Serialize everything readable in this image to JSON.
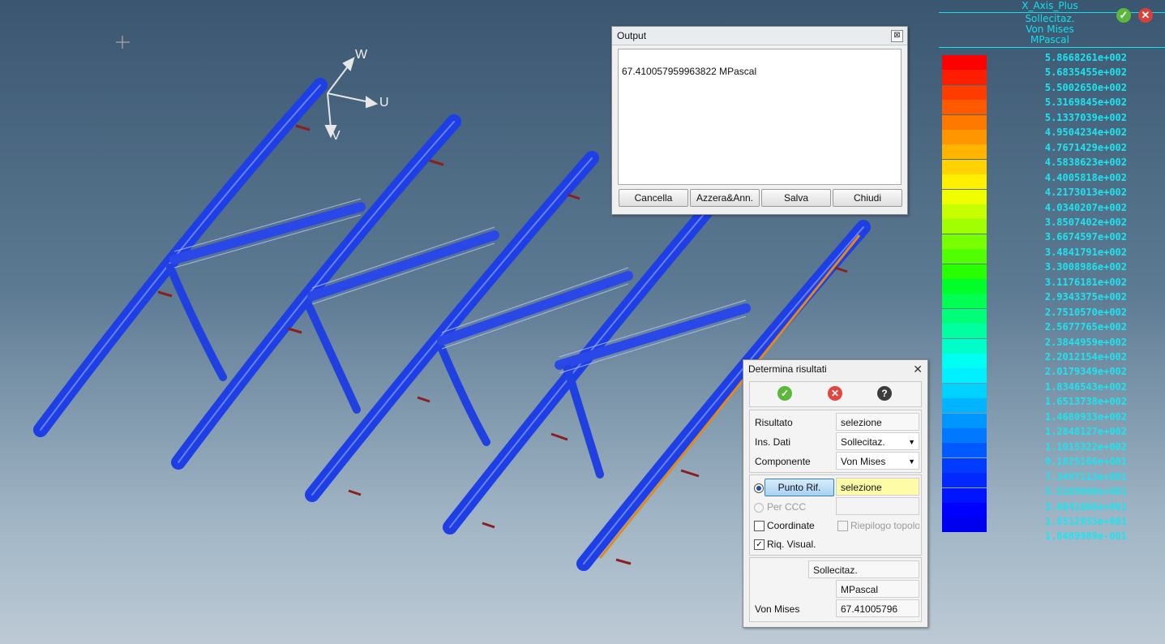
{
  "viewport": {
    "axes": {
      "w": "W",
      "u": "U",
      "v": "V"
    },
    "beam_color": "#1f3fe0",
    "background_top": "#3a5670"
  },
  "legend": {
    "title": "X_Axis_Plus",
    "line1": "Sollecitaz.",
    "line2": "Von Mises",
    "line3": "MPascal",
    "values": [
      "5.8668261e+002",
      "5.6835455e+002",
      "5.5002650e+002",
      "5.3169845e+002",
      "5.1337039e+002",
      "4.9504234e+002",
      "4.7671429e+002",
      "4.5838623e+002",
      "4.4005818e+002",
      "4.2173013e+002",
      "4.0340207e+002",
      "3.8507402e+002",
      "3.6674597e+002",
      "3.4841791e+002",
      "3.3008986e+002",
      "3.1176181e+002",
      "2.9343375e+002",
      "2.7510570e+002",
      "2.5677765e+002",
      "2.3844959e+002",
      "2.2012154e+002",
      "2.0179349e+002",
      "1.8346543e+002",
      "1.6513738e+002",
      "1.4680933e+002",
      "1.2848127e+002",
      "1.1015322e+002",
      "9.1825166e+001",
      "7.3497113e+001",
      "5.5169060e+001",
      "3.6841006e+001",
      "1.8512953e+001",
      "1.8489989e-001"
    ],
    "colors": [
      "#ff0000",
      "#ff1e00",
      "#ff3c00",
      "#ff5a00",
      "#ff7800",
      "#ff9600",
      "#ffb400",
      "#ffd200",
      "#fff000",
      "#f0ff00",
      "#c8ff00",
      "#a0ff00",
      "#78ff00",
      "#50ff00",
      "#28ff00",
      "#00ff28",
      "#00ff50",
      "#00ff78",
      "#00ffa0",
      "#00ffc8",
      "#00fff0",
      "#00f0ff",
      "#00d2ff",
      "#00b4ff",
      "#0096ff",
      "#0078ff",
      "#005aff",
      "#003cff",
      "#0028ff",
      "#0014ff",
      "#0000ff",
      "#0000f0",
      "#0000e6"
    ]
  },
  "output": {
    "title": "Output",
    "text": "67.410057959963822 MPascal",
    "buttons": {
      "cancella": "Cancella",
      "azzera": "Azzera&Ann.",
      "salva": "Salva",
      "chiudi": "Chiudi"
    }
  },
  "dialog": {
    "title": "Determina risultati",
    "risultato_label": "Risultato",
    "risultato_value": "selezione",
    "insdati_label": "Ins. Dati",
    "insdati_value": "Sollecitaz.",
    "componente_label": "Componente",
    "componente_value": "Von Mises",
    "punto_rif_label": "Punto Rif.",
    "punto_rif_value": "selezione",
    "per_ccc_label": "Per CCC",
    "coordinate_label": "Coordinate",
    "riepilogo_label": "Riepilogo topolo",
    "riq_label": "Riq. Visual.",
    "res_type": "Sollecitaz.",
    "res_unit": "MPascal",
    "vonmises_label": "Von Mises",
    "vonmises_value": "67.41005796"
  }
}
